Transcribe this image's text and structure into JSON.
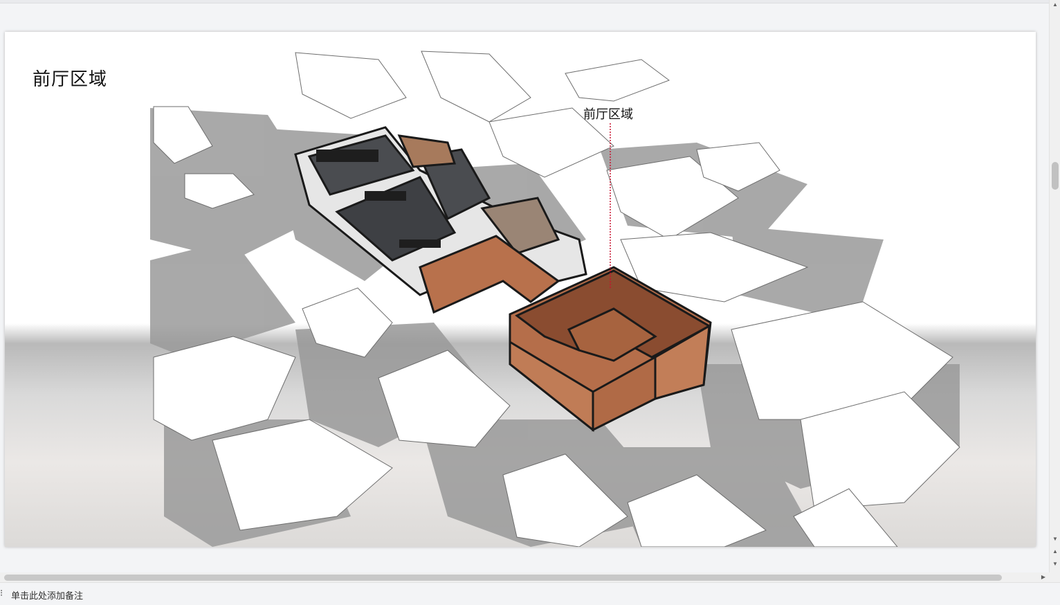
{
  "slide": {
    "title": "前厅区域",
    "callout_label": "前厅区域"
  },
  "notes": {
    "placeholder": "单击此处添加备注",
    "icon": "notes-icon"
  },
  "scrollbars": {
    "up_arrow": "▲",
    "down_arrow": "▼",
    "prev_page": "▲",
    "next_page": "▼",
    "right_arrow": "▶"
  },
  "colors": {
    "wood": "#b66f4a",
    "roof_dark": "#3b3d41",
    "callout_line": "#c8102e"
  }
}
